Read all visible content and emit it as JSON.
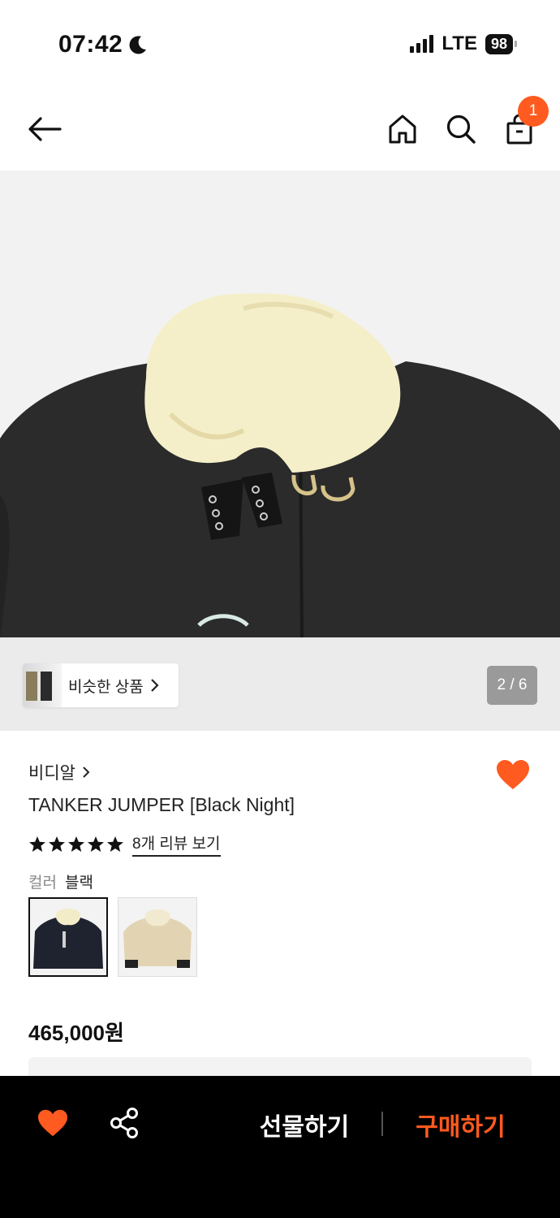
{
  "status": {
    "time": "07:42",
    "network": "LTE",
    "battery": "98"
  },
  "header": {
    "cart_count": "1"
  },
  "gallery": {
    "similar_label": "비슷한 상품",
    "counter": "2 / 6",
    "current_index": 2,
    "total": 6
  },
  "product": {
    "brand": "비디알",
    "title": "TANKER JUMPER [Black Night]",
    "rating_stars": 5,
    "review_link": "8개 리뷰 보기",
    "color_key": "컬러",
    "color_value": "블랙",
    "swatches": [
      {
        "name": "black",
        "selected": true
      },
      {
        "name": "beige",
        "selected": false
      }
    ],
    "price": "465,000원",
    "wishlisted": true
  },
  "bottom_bar": {
    "gift_label": "선물하기",
    "buy_label": "구매하기"
  },
  "colors": {
    "accent": "#ff5a1f",
    "bar": "#000000"
  },
  "icons": [
    "back-arrow-icon",
    "home-icon",
    "search-icon",
    "cart-icon",
    "heart-icon",
    "share-icon",
    "chevron-right-icon",
    "star-icon",
    "moon-icon"
  ]
}
